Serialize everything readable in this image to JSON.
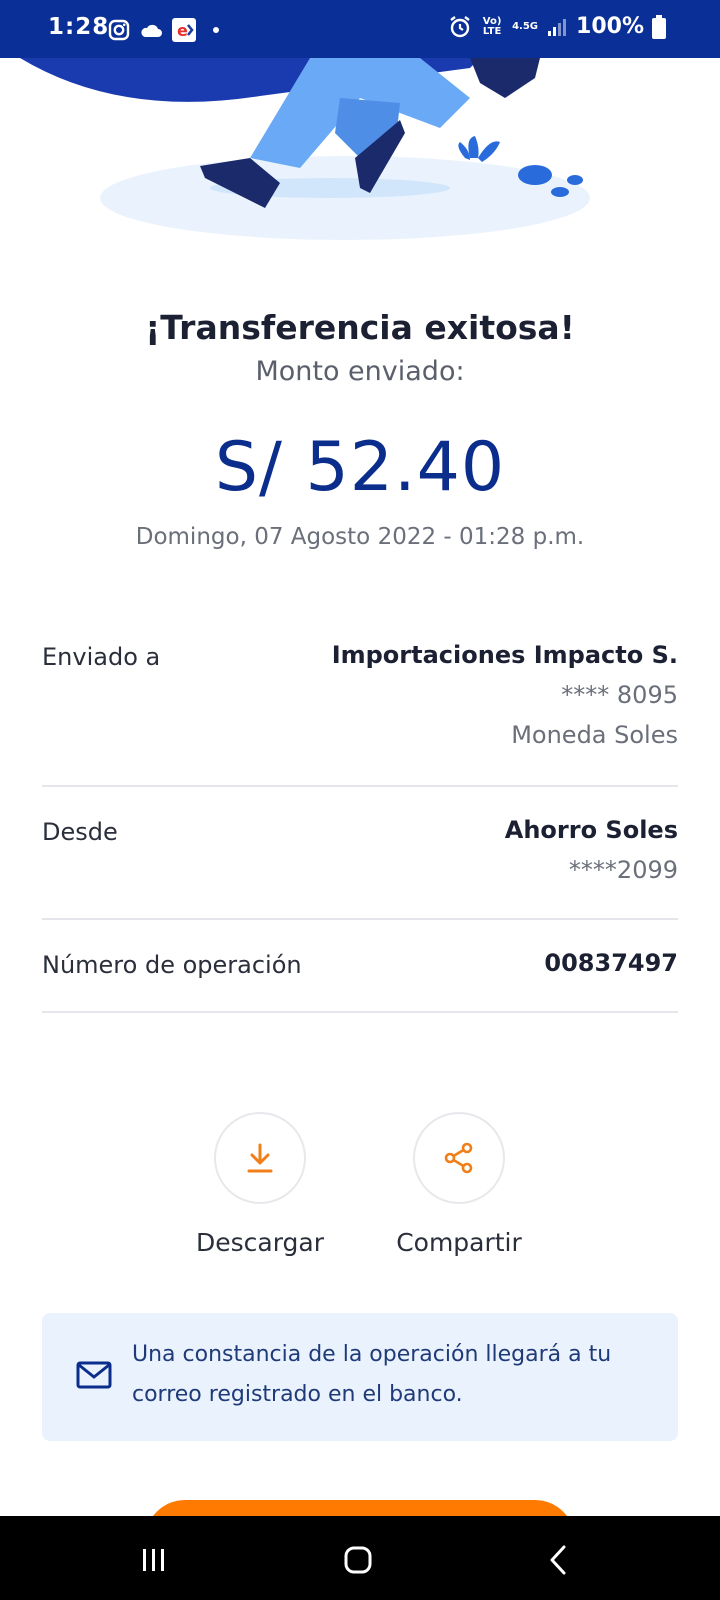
{
  "status_bar": {
    "time": "1:28",
    "network_label": "Vo) LTE",
    "network_speed": "4.5G",
    "battery": "100%"
  },
  "result": {
    "title": "¡Transferencia exitosa!",
    "amount_label": "Monto enviado:",
    "amount": "S/ 52.40",
    "datetime": "Domingo, 07 Agosto 2022 - 01:28 p.m."
  },
  "details": {
    "sent_to": {
      "label": "Enviado a",
      "name": "Importaciones Impacto S.",
      "account": "**** 8095",
      "currency": "Moneda Soles"
    },
    "from": {
      "label": "Desde",
      "account_name": "Ahorro Soles",
      "account": "****2099"
    },
    "operation": {
      "label": "Número de operación",
      "number": "00837497"
    }
  },
  "actions": {
    "download_label": "Descargar",
    "share_label": "Compartir"
  },
  "info": {
    "message": "Una constancia de la operación llegará a tu correo registrado en el banco."
  },
  "colors": {
    "brand_blue": "#0b2d8c",
    "accent_orange": "#ff7a00",
    "info_bg": "#eaf3fd"
  }
}
